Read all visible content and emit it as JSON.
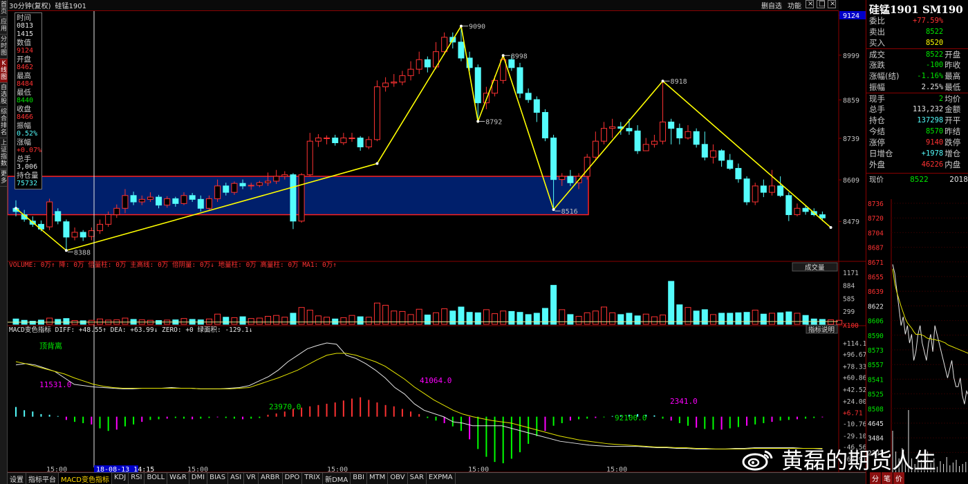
{
  "left_nav": [
    "首页",
    "应用",
    "分时图",
    "K线图",
    "自选股",
    "综合排名",
    "上证指数",
    "更多"
  ],
  "topbar": {
    "period": "30分钟(复权)",
    "instrument": "硅锰1901",
    "buttons": [
      "删自选",
      "功能"
    ],
    "box_buttons": [
      "×",
      "□",
      "×"
    ]
  },
  "infobox": [
    {
      "label": "时间",
      "value": "0813",
      "value2": "1415",
      "color": "white"
    },
    {
      "label": "数值",
      "value": "9124",
      "color": "red"
    },
    {
      "label": "开盘",
      "value": "8462",
      "color": "red"
    },
    {
      "label": "最高",
      "value": "8484",
      "color": "red"
    },
    {
      "label": "最低",
      "value": "8440",
      "color": "green"
    },
    {
      "label": "收盘",
      "value": "8466",
      "color": "red"
    },
    {
      "label": "振幅",
      "value": "0.52%",
      "color": "cyan"
    },
    {
      "label": "涨幅",
      "value": "+0.07%",
      "color": "red"
    },
    {
      "label": "总手",
      "value": "3,006",
      "color": "white"
    },
    {
      "label": "持仓量",
      "value": "75732",
      "color": "cyan"
    }
  ],
  "price_axis": [
    "9124",
    "8999",
    "8859",
    "8739",
    "8609",
    "8479"
  ],
  "annotations": [
    "9090",
    "8998",
    "8792",
    "8918",
    "8516",
    "8388"
  ],
  "volume_header": "VOLUME: 0万↑ 降: 0万 倍量柱: 0万 主高线: 0万 倍阴量: 0万↓ 地量柱: 0万 高量柱: 0万 MA1: 0万↑",
  "volume_dropdown": "成交量",
  "volume_axis": [
    "1171",
    "884",
    "585",
    "299",
    "X100"
  ],
  "macd_header": "MACD变色指标  DIFF: +48.55↑  DEA: +63.99↓  ZERO: +0  绿面积: -129.1↓",
  "macd_button": "指标说明",
  "macd_axis": [
    "+114.1",
    "+96.67",
    "+78.33",
    "+60.86",
    "+42.52",
    "+24.00",
    "+6.71",
    "-10.76",
    "-29.10",
    "-46.56",
    "-64.91"
  ],
  "macd_labels": {
    "divergence": "顶背离",
    "a1": "11531.0",
    "a2": "41064.0",
    "a3": "23970.0",
    "a4": "92100.0",
    "a5": "2341.0"
  },
  "time_axis": [
    "15:00",
    "18-08-13 14:15",
    "15:00",
    "15:00",
    "15:00",
    "15:00"
  ],
  "right_panel": {
    "title": "硅锰1901 SM190",
    "rows": [
      {
        "l": "委比",
        "v": "+77.59%",
        "vc": "red",
        "l2": "",
        "v2": ""
      },
      {
        "l": "卖出",
        "v": "8522",
        "vc": "green",
        "l2": "",
        "v2": ""
      },
      {
        "l": "买入",
        "v": "8520",
        "vc": "yellow",
        "l2": "",
        "v2": ""
      },
      {
        "l": "成交",
        "v": "8522",
        "vc": "green",
        "l2": "开盘",
        "v2": ""
      },
      {
        "l": "涨跌",
        "v": "-100",
        "vc": "green",
        "l2": "昨收",
        "v2": ""
      },
      {
        "l": "涨幅(结)",
        "v": "-1.16%",
        "vc": "green",
        "l2": "最高",
        "v2": ""
      },
      {
        "l": "振幅",
        "v": "2.25%",
        "vc": "white",
        "l2": "最低",
        "v2": ""
      },
      {
        "l": "现手",
        "v": "2",
        "vc": "green",
        "l2": "均价",
        "v2": ""
      },
      {
        "l": "总手",
        "v": "113,232",
        "vc": "white",
        "l2": "金额",
        "v2": ""
      },
      {
        "l": "持仓",
        "v": "137298",
        "vc": "cyan",
        "l2": "开平",
        "v2": ""
      },
      {
        "l": "今结",
        "v": "8570",
        "vc": "green",
        "l2": "昨结",
        "v2": ""
      },
      {
        "l": "涨停",
        "v": "9140",
        "vc": "red",
        "l2": "跌停",
        "v2": ""
      },
      {
        "l": "日增仓",
        "v": "+1978",
        "vc": "cyan",
        "l2": "增仓",
        "v2": ""
      },
      {
        "l": "外盘",
        "v": "46226",
        "vc": "red",
        "l2": "内盘",
        "v2": ""
      }
    ],
    "now_label": "现价",
    "now_value": "8522",
    "now_year": "2018",
    "tick_axis": [
      "8736",
      "8720",
      "8704",
      "8687",
      "8671",
      "8655",
      "8639",
      "8622",
      "8606",
      "8590",
      "8573",
      "8557",
      "8541",
      "8525",
      "8508",
      "4645",
      "3484",
      "2322"
    ]
  },
  "tabs": [
    "设置",
    "指标平台",
    "MACD变色指标",
    "KDJ",
    "RSI",
    "BOLL",
    "W&R",
    "DMI",
    "BIAS",
    "ASI",
    "VR",
    "ARBR",
    "DPO",
    "TRIX",
    "新DMA",
    "BBI",
    "MTM",
    "OBV",
    "SAR",
    "EXPMA"
  ],
  "active_tab": "MACD变色指标",
  "right_tabs": [
    "分",
    "笔",
    "价"
  ],
  "watermark": "黄磊的期货人生",
  "colors": {
    "up": "#ff3232",
    "down": "#54fcfc",
    "zigzag": "#ffff00",
    "zone_fill": "#001f6b",
    "zone_border": "#ff2020",
    "grid": "#8a0000"
  },
  "chart_data": {
    "type": "candlestick",
    "price_range": [
      8388,
      9124
    ],
    "candles": [
      [
        8520,
        8510,
        8545,
        8495
      ],
      [
        8500,
        8486,
        8515,
        8478
      ],
      [
        8480,
        8470,
        8495,
        8462
      ],
      [
        8470,
        8455,
        8482,
        8448
      ],
      [
        8462,
        8540,
        8550,
        8452
      ],
      [
        8510,
        8480,
        8520,
        8470
      ],
      [
        8478,
        8430,
        8485,
        8388
      ],
      [
        8430,
        8445,
        8460,
        8420
      ],
      [
        8445,
        8430,
        8452,
        8418
      ],
      [
        8432,
        8450,
        8460,
        8420
      ],
      [
        8450,
        8470,
        8485,
        8440
      ],
      [
        8470,
        8500,
        8510,
        8462
      ],
      [
        8500,
        8520,
        8532,
        8490
      ],
      [
        8520,
        8560,
        8580,
        8505
      ],
      [
        8560,
        8540,
        8572,
        8530
      ],
      [
        8540,
        8548,
        8560,
        8530
      ],
      [
        8548,
        8555,
        8570,
        8540
      ],
      [
        8555,
        8530,
        8562,
        8520
      ],
      [
        8530,
        8550,
        8558,
        8522
      ],
      [
        8550,
        8535,
        8556,
        8525
      ],
      [
        8535,
        8560,
        8570,
        8530
      ],
      [
        8560,
        8548,
        8568,
        8540
      ],
      [
        8548,
        8520,
        8560,
        8510
      ],
      [
        8520,
        8550,
        8560,
        8515
      ],
      [
        8550,
        8590,
        8610,
        8540
      ],
      [
        8590,
        8570,
        8600,
        8560
      ],
      [
        8570,
        8598,
        8604,
        8562
      ],
      [
        8598,
        8590,
        8610,
        8580
      ],
      [
        8590,
        8592,
        8600,
        8578
      ],
      [
        8592,
        8600,
        8606,
        8586
      ],
      [
        8600,
        8605,
        8632,
        8590
      ],
      [
        8605,
        8620,
        8640,
        8596
      ],
      [
        8620,
        8625,
        8636,
        8610
      ],
      [
        8625,
        8480,
        8630,
        8455
      ],
      [
        8480,
        8625,
        8630,
        8475
      ],
      [
        8625,
        8730,
        8756,
        8620
      ],
      [
        8730,
        8740,
        8752,
        8712
      ],
      [
        8740,
        8740,
        8748,
        8720
      ],
      [
        8740,
        8725,
        8750,
        8716
      ],
      [
        8725,
        8740,
        8756,
        8718
      ],
      [
        8740,
        8740,
        8756,
        8728
      ],
      [
        8740,
        8712,
        8746,
        8700
      ],
      [
        8712,
        8735,
        8745,
        8705
      ],
      [
        8735,
        8900,
        8920,
        8730
      ],
      [
        8900,
        8912,
        8930,
        8885
      ],
      [
        8912,
        8915,
        8940,
        8900
      ],
      [
        8915,
        8935,
        8950,
        8905
      ],
      [
        8935,
        8955,
        8980,
        8920
      ],
      [
        8955,
        8985,
        9010,
        8940
      ],
      [
        8985,
        8962,
        8995,
        8945
      ],
      [
        8962,
        9010,
        9040,
        8955
      ],
      [
        9010,
        9055,
        9070,
        9000
      ],
      [
        9055,
        9040,
        9070,
        9020
      ],
      [
        9040,
        8990,
        9090,
        8980
      ],
      [
        8990,
        8960,
        9010,
        8950
      ],
      [
        8960,
        8850,
        8970,
        8792
      ],
      [
        8850,
        8880,
        8900,
        8830
      ],
      [
        8880,
        8920,
        8935,
        8870
      ],
      [
        8920,
        8985,
        8998,
        8910
      ],
      [
        8985,
        8960,
        8998,
        8950
      ],
      [
        8960,
        8880,
        8975,
        8865
      ],
      [
        8880,
        8860,
        8895,
        8850
      ],
      [
        8860,
        8820,
        8870,
        8790
      ],
      [
        8820,
        8740,
        8830,
        8730
      ],
      [
        8740,
        8610,
        8750,
        8516
      ],
      [
        8610,
        8620,
        8630,
        8590
      ],
      [
        8620,
        8600,
        8640,
        8590
      ],
      [
        8600,
        8620,
        8630,
        8580
      ],
      [
        8620,
        8680,
        8690,
        8610
      ],
      [
        8680,
        8730,
        8760,
        8670
      ],
      [
        8730,
        8770,
        8790,
        8720
      ],
      [
        8770,
        8775,
        8800,
        8740
      ],
      [
        8775,
        8770,
        8790,
        8750
      ],
      [
        8770,
        8762,
        8800,
        8750
      ],
      [
        8762,
        8700,
        8780,
        8690
      ],
      [
        8700,
        8720,
        8740,
        8700
      ],
      [
        8720,
        8730,
        8750,
        8710
      ],
      [
        8730,
        8790,
        8918,
        8720
      ],
      [
        8790,
        8770,
        8800,
        8720
      ],
      [
        8770,
        8740,
        8785,
        8720
      ],
      [
        8740,
        8760,
        8780,
        8735
      ],
      [
        8760,
        8720,
        8770,
        8710
      ],
      [
        8720,
        8680,
        8760,
        8670
      ],
      [
        8680,
        8700,
        8720,
        8660
      ],
      [
        8700,
        8670,
        8705,
        8650
      ],
      [
        8670,
        8645,
        8690,
        8640
      ],
      [
        8645,
        8612,
        8660,
        8600
      ],
      [
        8612,
        8540,
        8620,
        8530
      ],
      [
        8540,
        8590,
        8600,
        8530
      ],
      [
        8590,
        8570,
        8610,
        8555
      ],
      [
        8570,
        8590,
        8640,
        8560
      ],
      [
        8590,
        8560,
        8620,
        8555
      ],
      [
        8560,
        8500,
        8570,
        8480
      ],
      [
        8500,
        8520,
        8535,
        8495
      ],
      [
        8520,
        8510,
        8530,
        8500
      ],
      [
        8510,
        8500,
        8520,
        8495
      ],
      [
        8500,
        8490,
        8510,
        8480
      ]
    ],
    "zigzag": [
      [
        0,
        8520
      ],
      [
        6,
        8388
      ],
      [
        43,
        8660
      ],
      [
        53,
        9090
      ],
      [
        55,
        8792
      ],
      [
        58,
        8998
      ],
      [
        64,
        8516
      ],
      [
        77,
        8918
      ],
      [
        97,
        8460
      ]
    ],
    "zone": [
      8500,
      8620
    ],
    "volume": [
      120,
      90,
      70,
      95,
      140,
      110,
      130,
      85,
      80,
      90,
      120,
      95,
      100,
      140,
      110,
      100,
      90,
      85,
      95,
      100,
      130,
      110,
      100,
      120,
      230,
      160,
      150,
      170,
      130,
      140,
      180,
      200,
      160,
      250,
      380,
      320,
      190,
      160,
      120,
      150,
      200,
      170,
      160,
      480,
      430,
      300,
      290,
      220,
      340,
      210,
      260,
      350,
      300,
      390,
      270,
      260,
      330,
      240,
      300,
      290,
      270,
      220,
      250,
      360,
      880,
      330,
      220,
      180,
      260,
      300,
      390,
      260,
      220,
      250,
      190,
      230,
      170,
      210,
      970,
      440,
      380,
      300,
      330,
      220,
      250,
      250,
      260,
      270,
      320,
      230,
      250,
      260,
      280,
      250,
      200,
      120,
      110,
      100,
      90
    ],
    "macd_hist": [
      15,
      10,
      8,
      4,
      3,
      1,
      -5,
      -8,
      -10,
      -12,
      -18,
      -22,
      -20,
      -15,
      -12,
      -8,
      -5,
      -4,
      -3,
      -2,
      -3,
      -4,
      -3,
      -2,
      -1,
      -2,
      -3,
      -4,
      -3,
      -2,
      3,
      5,
      8,
      12,
      14,
      16,
      18,
      20,
      22,
      25,
      28,
      30,
      26,
      22,
      18,
      16,
      12,
      8,
      4,
      -2,
      -6,
      -10,
      -15,
      -22,
      -35,
      -50,
      -62,
      -70,
      -72,
      -65,
      -55,
      -42,
      -30,
      -22,
      -14,
      -10,
      -6,
      -4,
      -3,
      -2,
      -1,
      1,
      2,
      3,
      4,
      3,
      2,
      -3,
      -6,
      -10,
      -14,
      -17,
      -19,
      -20,
      -20,
      -18,
      -16,
      -14,
      -12,
      -10,
      -8,
      -6,
      -5,
      -4,
      -3,
      -2,
      -1
    ],
    "macd_diff": [
      80,
      82,
      80,
      75,
      70,
      60,
      50,
      48,
      46,
      45,
      44,
      43,
      43,
      44,
      44,
      44,
      45,
      44,
      44,
      43,
      43,
      43,
      44,
      45,
      48,
      55,
      62,
      72,
      85,
      95,
      105,
      110,
      114,
      112,
      95,
      90,
      82,
      72,
      60,
      45,
      35,
      20,
      10,
      5,
      0,
      -8,
      -10,
      -14,
      -14,
      -14,
      -14,
      -18,
      -22,
      -26,
      -30,
      -34,
      -38,
      -40,
      -42,
      -44,
      -45,
      -46,
      -46,
      -46,
      -46,
      -47,
      -48,
      -48,
      -49,
      -49,
      -50,
      -50,
      -50,
      -50,
      -49,
      -49,
      -48,
      -48,
      -48,
      -48,
      -48,
      -49,
      -49,
      -50
    ],
    "macd_dea": [
      85,
      82,
      78,
      74,
      70,
      66,
      60,
      55,
      50,
      47,
      45,
      44,
      44,
      44,
      44,
      44,
      44,
      44,
      44,
      43,
      43,
      43,
      43,
      44,
      45,
      50,
      55,
      60,
      66,
      72,
      80,
      88,
      95,
      98,
      98,
      95,
      90,
      85,
      78,
      68,
      58,
      46,
      36,
      26,
      18,
      10,
      4,
      0,
      -3,
      -6,
      -8,
      -10,
      -14,
      -18,
      -22,
      -26,
      -30,
      -33,
      -36,
      -38,
      -40,
      -42,
      -43,
      -44,
      -45,
      -46,
      -47,
      -47,
      -48,
      -48,
      -49,
      -49,
      -50,
      -50,
      -50,
      -50,
      -49,
      -49,
      -49,
      -49,
      -49,
      -49,
      -49,
      -49
    ],
    "tick_price": [
      8670,
      8660,
      8640,
      8620,
      8600,
      8610,
      8590,
      8600,
      8580,
      8590,
      8560,
      8570,
      8590,
      8600,
      8580,
      8570,
      8560,
      8580,
      8590,
      8570,
      8600,
      8590,
      8580,
      8570,
      8560,
      8550,
      8540,
      8550,
      8560,
      8540,
      8530,
      8530,
      8540,
      8520,
      8510,
      8525,
      8520
    ],
    "tick_avg": [
      8665,
      8648,
      8638,
      8630,
      8622,
      8615,
      8608,
      8603,
      8600,
      8597,
      8593,
      8590,
      8590,
      8590,
      8589,
      8588,
      8586,
      8585,
      8585,
      8584,
      8584,
      8583,
      8583,
      8582,
      8581,
      8580,
      8578,
      8577,
      8576,
      8575,
      8574,
      8573,
      8572,
      8571,
      8570,
      8569,
      8568
    ]
  }
}
